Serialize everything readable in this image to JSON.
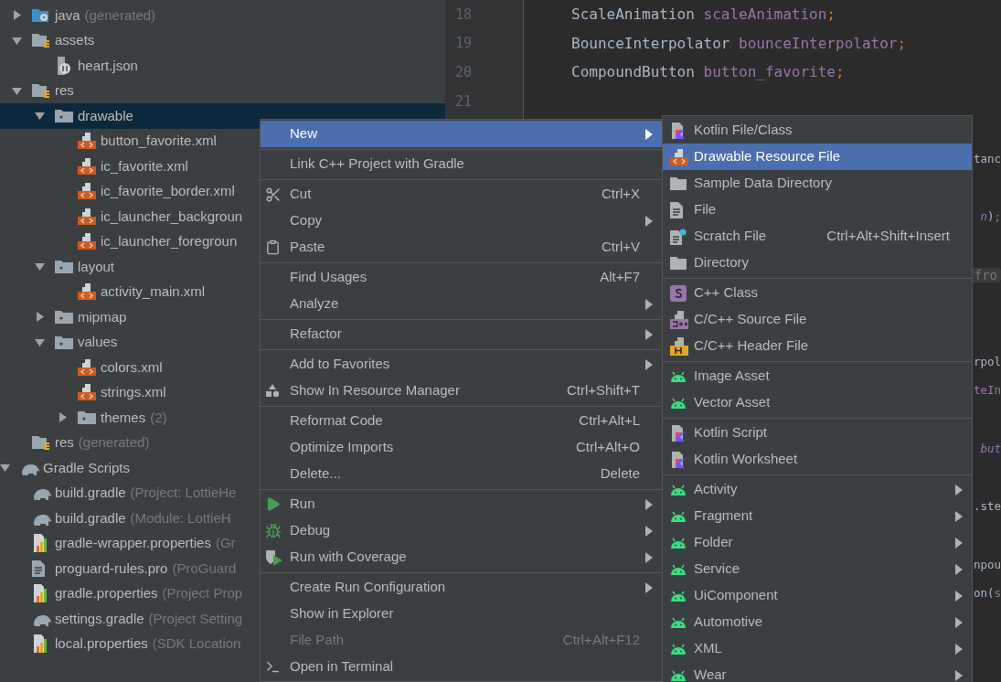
{
  "project_tree": [
    {
      "children": [
        {
          "label": "java",
          "suffix": "(generated)",
          "kind": "folder-java",
          "expanded": false,
          "selected": false
        },
        {
          "label": "assets",
          "kind": "folder-res",
          "expanded": true,
          "selected": false,
          "children": [
            {
              "label": "heart.json",
              "kind": "json",
              "selected": false
            }
          ]
        },
        {
          "label": "res",
          "kind": "folder-res",
          "expanded": true,
          "selected": false,
          "children": [
            {
              "label": "drawable",
              "kind": "folder",
              "expanded": true,
              "selected": true,
              "children": [
                {
                  "label": "button_favorite.xml",
                  "kind": "xml",
                  "selected": false
                },
                {
                  "label": "ic_favorite.xml",
                  "kind": "xml",
                  "selected": false
                },
                {
                  "label": "ic_favorite_border.xml",
                  "kind": "xml",
                  "selected": false
                },
                {
                  "label": "ic_launcher_backgroun",
                  "kind": "xml",
                  "selected": false
                },
                {
                  "label": "ic_launcher_foregroun",
                  "kind": "xml",
                  "selected": false
                }
              ]
            },
            {
              "label": "layout",
              "kind": "folder",
              "expanded": true,
              "selected": false,
              "children": [
                {
                  "label": "activity_main.xml",
                  "kind": "xml",
                  "selected": false
                }
              ]
            },
            {
              "label": "mipmap",
              "kind": "folder",
              "expanded": false,
              "selected": false
            },
            {
              "label": "values",
              "kind": "folder",
              "expanded": true,
              "selected": false,
              "children": [
                {
                  "label": "colors.xml",
                  "kind": "xml",
                  "selected": false
                },
                {
                  "label": "strings.xml",
                  "kind": "xml",
                  "selected": false
                },
                {
                  "label": "themes",
                  "suffix": "(2)",
                  "kind": "folder",
                  "expanded": false,
                  "selected": false
                }
              ]
            }
          ]
        },
        {
          "label": "res",
          "suffix": "(generated)",
          "kind": "folder-res",
          "selected": false
        }
      ]
    },
    {
      "label": "Gradle Scripts",
      "kind": "gradle",
      "expanded": true,
      "selected": false,
      "children": [
        {
          "label": "build.gradle",
          "suffix": "(Project: LottieHe",
          "kind": "gradle",
          "selected": false
        },
        {
          "label": "build.gradle",
          "suffix": "(Module: LottieH",
          "kind": "gradle",
          "selected": false
        },
        {
          "label": "gradle-wrapper.properties",
          "suffix": "(Gr",
          "kind": "props",
          "selected": false
        },
        {
          "label": "proguard-rules.pro",
          "suffix": "(ProGuard",
          "kind": "text",
          "selected": false
        },
        {
          "label": "gradle.properties",
          "suffix": "(Project Prop",
          "kind": "props",
          "selected": false
        },
        {
          "label": "settings.gradle",
          "suffix": "(Project Setting",
          "kind": "gradle",
          "selected": false
        },
        {
          "label": "local.properties",
          "suffix": "(SDK Location",
          "kind": "props",
          "selected": false
        }
      ]
    }
  ],
  "editor": {
    "lines": [
      {
        "kind": "code",
        "number": "18",
        "tokens": [
          {
            "kind": "type",
            "text": "ScaleAnimation "
          },
          {
            "kind": "field",
            "text": "scaleAnimation"
          },
          {
            "kind": "punct",
            "text": ";"
          }
        ]
      },
      {
        "kind": "code",
        "number": "19",
        "tokens": [
          {
            "kind": "type",
            "text": "BounceInterpolator "
          },
          {
            "kind": "field",
            "text": "bounceInterpolator"
          },
          {
            "kind": "punct",
            "text": ";"
          }
        ]
      },
      {
        "kind": "code",
        "number": "20",
        "tokens": [
          {
            "kind": "type",
            "text": "CompoundButton "
          },
          {
            "kind": "field",
            "text": "button_favorite"
          },
          {
            "kind": "punct",
            "text": ";"
          }
        ]
      },
      {
        "kind": "code",
        "number": "21"
      },
      {
        "kind": "blank"
      },
      {
        "kind": "code",
        "tokens": [
          {
            "kind": "type",
            "text": "tanc"
          }
        ]
      },
      {
        "kind": "blank"
      },
      {
        "kind": "code",
        "tokens": [
          {
            "kind": "field-italic",
            "text": "n"
          },
          {
            "kind": "type",
            "text": ")"
          },
          {
            "kind": "punct",
            "text": ";"
          }
        ]
      },
      {
        "kind": "blank"
      },
      {
        "kind": "code",
        "tokens": [
          {
            "kind": "hint",
            "text": "fro"
          }
        ]
      },
      {
        "kind": "blank"
      },
      {
        "kind": "blank"
      },
      {
        "kind": "code",
        "tokens": [
          {
            "kind": "type",
            "text": "rpol"
          }
        ]
      },
      {
        "kind": "code",
        "tokens": [
          {
            "kind": "field",
            "text": "teIn"
          }
        ]
      },
      {
        "kind": "blank"
      },
      {
        "kind": "code",
        "tokens": [
          {
            "kind": "field-italic",
            "text": "but"
          }
        ]
      },
      {
        "kind": "blank"
      },
      {
        "kind": "code",
        "tokens": [
          {
            "kind": "type",
            "text": ".ste"
          }
        ]
      },
      {
        "kind": "blank"
      },
      {
        "kind": "code",
        "tokens": [
          {
            "kind": "type",
            "text": "npou"
          }
        ]
      },
      {
        "kind": "code",
        "tokens": [
          {
            "kind": "type",
            "text": "on("
          },
          {
            "kind": "field",
            "text": "s"
          }
        ]
      }
    ]
  },
  "context_menu": [
    {
      "kind": "plain",
      "label": "New",
      "submenu": true,
      "selected": true,
      "disabled": false
    },
    {
      "kind": "separator"
    },
    {
      "kind": "plain",
      "label": "Link C++ Project with Gradle",
      "submenu": false,
      "selected": false,
      "disabled": false
    },
    {
      "kind": "separator"
    },
    {
      "kind": "scissors",
      "label": "Cut",
      "shortcut": "Ctrl+X",
      "submenu": false,
      "selected": false,
      "disabled": false
    },
    {
      "kind": "plain",
      "label": "Copy",
      "submenu": true,
      "selected": false,
      "disabled": false
    },
    {
      "kind": "clipboard",
      "label": "Paste",
      "shortcut": "Ctrl+V",
      "submenu": false,
      "selected": false,
      "disabled": false
    },
    {
      "kind": "separator"
    },
    {
      "kind": "plain",
      "label": "Find Usages",
      "shortcut": "Alt+F7",
      "submenu": false,
      "selected": false,
      "disabled": false
    },
    {
      "kind": "plain",
      "label": "Analyze",
      "submenu": true,
      "selected": false,
      "disabled": false
    },
    {
      "kind": "separator"
    },
    {
      "kind": "plain",
      "label": "Refactor",
      "submenu": true,
      "selected": false,
      "disabled": false
    },
    {
      "kind": "separator"
    },
    {
      "kind": "plain",
      "label": "Add to Favorites",
      "submenu": true,
      "selected": false,
      "disabled": false
    },
    {
      "kind": "shapes",
      "label": "Show In Resource Manager",
      "shortcut": "Ctrl+Shift+T",
      "submenu": false,
      "selected": false,
      "disabled": false
    },
    {
      "kind": "separator"
    },
    {
      "kind": "plain",
      "label": "Reformat Code",
      "shortcut": "Ctrl+Alt+L",
      "submenu": false,
      "selected": false,
      "disabled": false
    },
    {
      "kind": "plain",
      "label": "Optimize Imports",
      "shortcut": "Ctrl+Alt+O",
      "submenu": false,
      "selected": false,
      "disabled": false
    },
    {
      "kind": "plain",
      "label": "Delete...",
      "shortcut": "Delete",
      "submenu": false,
      "selected": false,
      "disabled": false
    },
    {
      "kind": "separator"
    },
    {
      "kind": "play",
      "label": "Run",
      "submenu": true,
      "selected": false,
      "disabled": false
    },
    {
      "kind": "bug",
      "label": "Debug",
      "submenu": true,
      "selected": false,
      "disabled": false
    },
    {
      "kind": "coverage",
      "label": "Run with Coverage",
      "submenu": true,
      "selected": false,
      "disabled": false
    },
    {
      "kind": "separator"
    },
    {
      "kind": "plain",
      "label": "Create Run Configuration",
      "submenu": true,
      "selected": false,
      "disabled": false
    },
    {
      "kind": "plain",
      "label": "Show in Explorer",
      "submenu": false,
      "selected": false,
      "disabled": false
    },
    {
      "kind": "plain",
      "label": "File Path",
      "shortcut": "Ctrl+Alt+F12",
      "submenu": false,
      "selected": false,
      "disabled": true
    },
    {
      "kind": "terminal",
      "label": "Open in Terminal",
      "submenu": false,
      "selected": false,
      "disabled": false
    }
  ],
  "new_submenu": [
    {
      "kind": "kotlin",
      "label": "Kotlin File/Class",
      "submenu": false,
      "selected": false
    },
    {
      "kind": "xml",
      "label": "Drawable Resource File",
      "submenu": false,
      "selected": true
    },
    {
      "kind": "folder",
      "label": "Sample Data Directory",
      "submenu": false,
      "selected": false
    },
    {
      "kind": "file",
      "label": "File",
      "submenu": false,
      "selected": false
    },
    {
      "kind": "scratch",
      "label": "Scratch File",
      "shortcut": "Ctrl+Alt+Shift+Insert",
      "submenu": false,
      "selected": false
    },
    {
      "kind": "folder",
      "label": "Directory",
      "submenu": false,
      "selected": false
    },
    {
      "kind": "separator"
    },
    {
      "kind": "cpp-class",
      "label": "C++ Class",
      "submenu": false,
      "selected": false
    },
    {
      "kind": "cpp-source",
      "label": "C/C++ Source File",
      "submenu": false,
      "selected": false
    },
    {
      "kind": "cpp-header",
      "label": "C/C++ Header File",
      "submenu": false,
      "selected": false
    },
    {
      "kind": "separator"
    },
    {
      "kind": "android",
      "label": "Image Asset",
      "submenu": false,
      "selected": false
    },
    {
      "kind": "android",
      "label": "Vector Asset",
      "submenu": false,
      "selected": false
    },
    {
      "kind": "separator"
    },
    {
      "kind": "kotlin",
      "label": "Kotlin Script",
      "submenu": false,
      "selected": false
    },
    {
      "kind": "kotlin",
      "label": "Kotlin Worksheet",
      "submenu": false,
      "selected": false
    },
    {
      "kind": "separator"
    },
    {
      "kind": "android",
      "label": "Activity",
      "submenu": true,
      "selected": false
    },
    {
      "kind": "android",
      "label": "Fragment",
      "submenu": true,
      "selected": false
    },
    {
      "kind": "android",
      "label": "Folder",
      "submenu": true,
      "selected": false
    },
    {
      "kind": "android",
      "label": "Service",
      "submenu": true,
      "selected": false
    },
    {
      "kind": "android",
      "label": "UiComponent",
      "submenu": true,
      "selected": false
    },
    {
      "kind": "android",
      "label": "Automotive",
      "submenu": true,
      "selected": false
    },
    {
      "kind": "android",
      "label": "XML",
      "submenu": true,
      "selected": false
    },
    {
      "kind": "android",
      "label": "Wear",
      "submenu": true,
      "selected": false
    }
  ]
}
